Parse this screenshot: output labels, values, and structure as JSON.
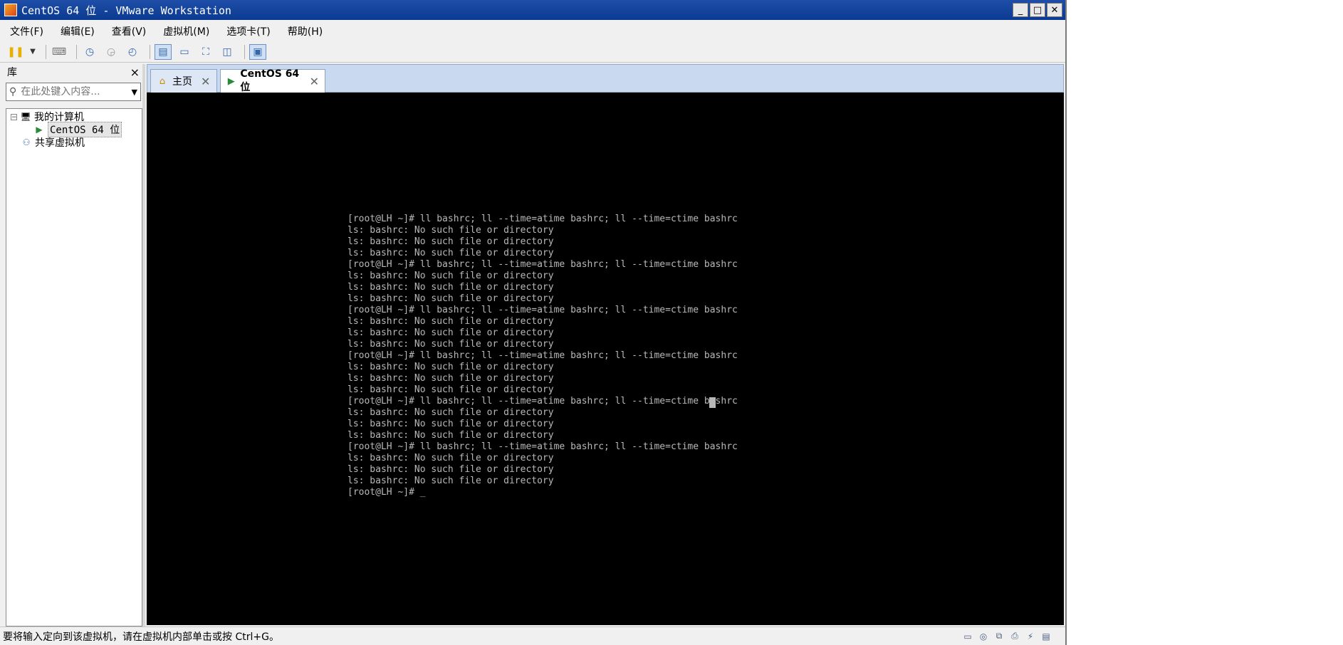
{
  "window": {
    "title": "CentOS 64 位 - VMware Workstation",
    "controls": {
      "minimize": "_",
      "maximize": "□",
      "close": "✕"
    }
  },
  "menu": {
    "items": [
      "文件(F)",
      "编辑(E)",
      "查看(V)",
      "虚拟机(M)",
      "选项卡(T)",
      "帮助(H)"
    ]
  },
  "toolbar": {
    "icons": [
      "pause-icon",
      "dropdown-icon",
      "send-keys-icon",
      "snapshot-icon",
      "revert-snapshot-icon",
      "snapshot-manager-icon",
      "show-library-icon",
      "thumbnail-bar-icon",
      "full-screen-icon",
      "unity-icon",
      "console-view-icon"
    ]
  },
  "library": {
    "title": "库",
    "close": "×",
    "search_placeholder": "在此处键入内容...",
    "tree": {
      "my_computer": "我的计算机",
      "vm": "CentOS 64 位",
      "shared": "共享虚拟机",
      "expander": "−"
    }
  },
  "tabs": [
    {
      "label": "主页",
      "icon": "home-icon",
      "active": false
    },
    {
      "label": "CentOS 64 位",
      "icon": "vm-icon",
      "active": true
    }
  ],
  "console": {
    "lines": [
      "[root@LH ~]# ll bashrc; ll --time=atime bashrc; ll --time=ctime bashrc",
      "ls: bashrc: No such file or directory",
      "ls: bashrc: No such file or directory",
      "ls: bashrc: No such file or directory",
      "[root@LH ~]# ll bashrc; ll --time=atime bashrc; ll --time=ctime bashrc",
      "ls: bashrc: No such file or directory",
      "ls: bashrc: No such file or directory",
      "ls: bashrc: No such file or directory",
      "[root@LH ~]# ll bashrc; ll --time=atime bashrc; ll --time=ctime bashrc",
      "ls: bashrc: No such file or directory",
      "ls: bashrc: No such file or directory",
      "ls: bashrc: No such file or directory",
      "[root@LH ~]# ll bashrc; ll --time=atime bashrc; ll --time=ctime bashrc",
      "ls: bashrc: No such file or directory",
      "ls: bashrc: No such file or directory",
      "ls: bashrc: No such file or directory",
      "[root@LH ~]# ll bashrc; ll --time=atime bashrc; ll --time=ctime bashrc",
      "ls: bashrc: No such file or directory",
      "ls: bashrc: No such file or directory",
      "ls: bashrc: No such file or directory",
      "[root@LH ~]# ll bashrc; ll --time=atime bashrc; ll --time=ctime bashrc",
      "ls: bashrc: No such file or directory",
      "ls: bashrc: No such file or directory",
      "ls: bashrc: No such file or directory",
      "[root@LH ~]# _"
    ]
  },
  "status": {
    "text": "要将输入定向到该虚拟机，请在虚拟机内部单击或按 Ctrl+G。",
    "icons": [
      "hdd-icon",
      "cdrom-icon",
      "network-icon",
      "printer-icon",
      "usb-icon",
      "message-icon"
    ]
  },
  "colors": {
    "titlebar": "#0b3a92",
    "console_bg": "#000000",
    "console_fg": "#b8b8b8",
    "tab_bar": "#c9d9f0"
  }
}
